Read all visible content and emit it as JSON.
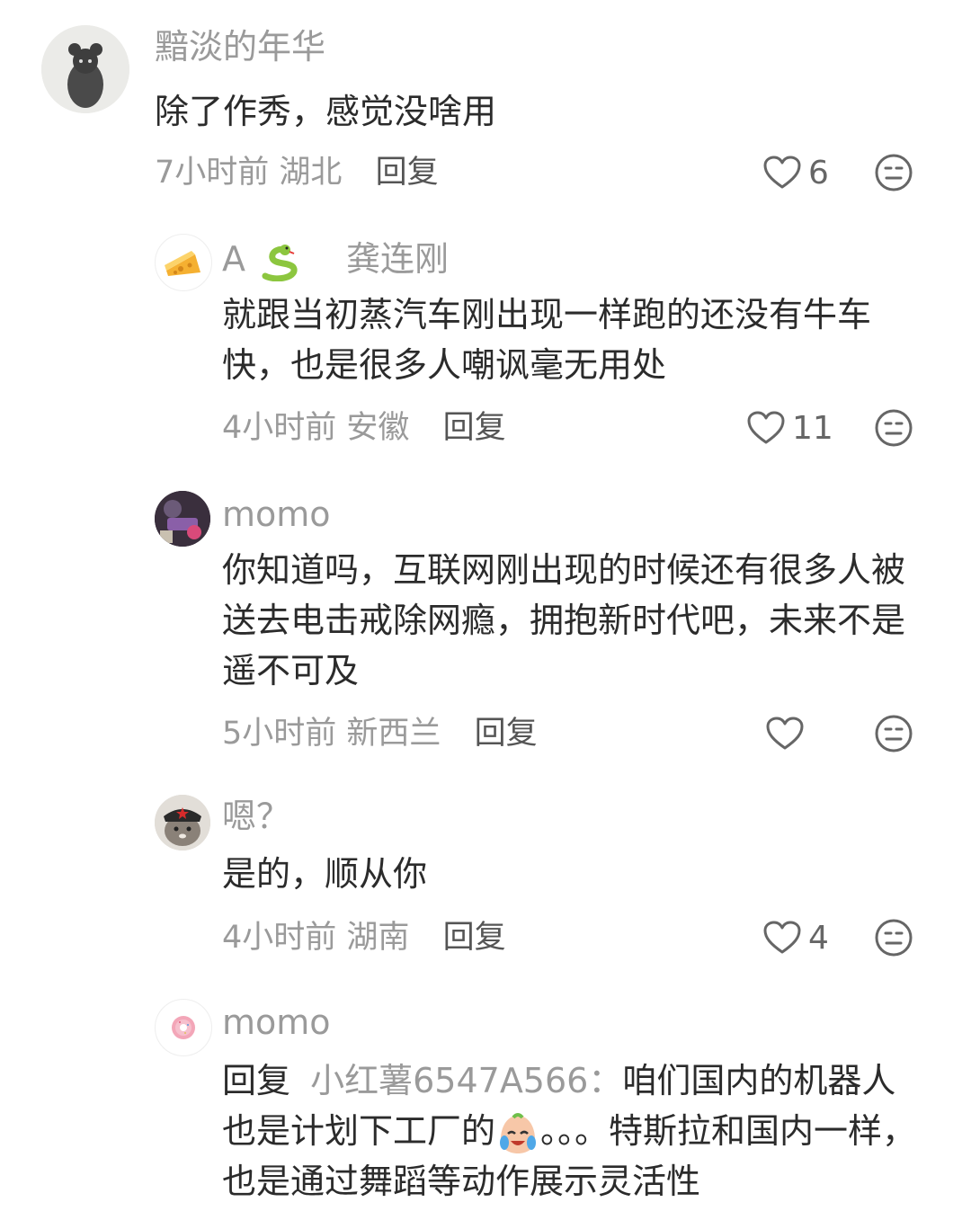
{
  "comments": [
    {
      "name": "黯淡的年华",
      "text": "除了作秀，感觉没啥用",
      "time": "7小时前",
      "location": "湖北",
      "reply_label": "回复",
      "likes": "6"
    },
    {
      "name": "A",
      "name_emoji": "snake",
      "reply_to_name": "龚连刚",
      "text": "就跟当初蒸汽车刚出现一样跑的还没有牛车快，也是很多人嘲讽毫无用处",
      "time": "4小时前",
      "location": "安徽",
      "reply_label": "回复",
      "likes": "11"
    },
    {
      "name": "momo",
      "text": "你知道吗，互联网刚出现的时候还有很多人被送去电击戒除网瘾，拥抱新时代吧，未来不是遥不可及",
      "time": "5小时前",
      "location": "新西兰",
      "reply_label": "回复",
      "likes": ""
    },
    {
      "name": "嗯？",
      "text": "是的，顺从你",
      "time": "4小时前",
      "location": "湖南",
      "reply_label": "回复",
      "likes": "4"
    },
    {
      "name": "momo",
      "reply_prefix": "回复",
      "reply_target": "小红薯6547A566：",
      "text_part1": "咱们国内的机器人也是计划下工厂的",
      "text_part2": "。。。特斯拉和国内一样，也是通过舞蹈等动作展示灵活性"
    }
  ],
  "icons": {
    "like": "heart-outline-icon",
    "react": "neutral-face-icon"
  },
  "colors": {
    "muted_text": "#9a9a9a",
    "body_text": "#2b2b2b",
    "icon_stroke": "#666666"
  }
}
